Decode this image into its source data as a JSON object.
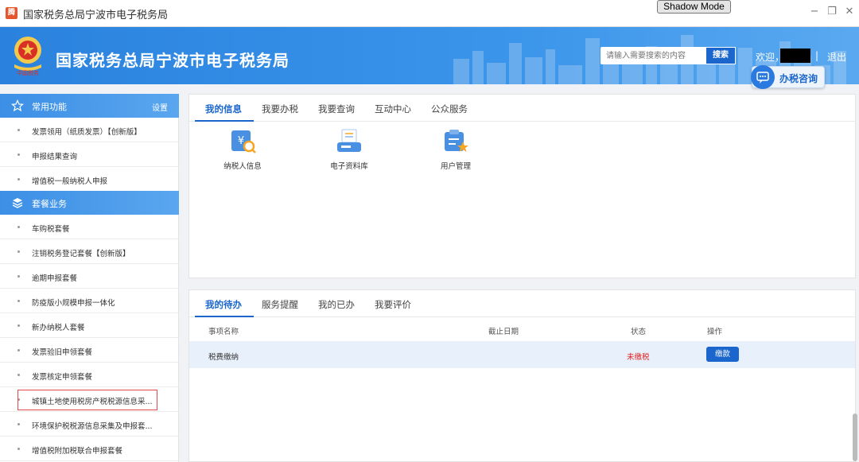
{
  "window": {
    "app_icon_text": "腾",
    "title": "国家税务总局宁波市电子税务局",
    "shadow_mode": "Shadow Mode",
    "controls": [
      "−",
      "❐",
      "✕"
    ]
  },
  "header": {
    "site_title": "国家税务总局宁波市电子税务局",
    "search_placeholder": "请输入需要搜索的内容",
    "search_button": "搜索",
    "welcome": "欢迎，",
    "separator": "|",
    "logout": "退出",
    "consult": "办税咨询"
  },
  "sidebar": {
    "common_section": {
      "label": "常用功能",
      "setting": "设置"
    },
    "common_items": [
      "发票领用（纸质发票）【创新版】",
      "申报结果查询",
      "增值税一般纳税人申报"
    ],
    "package_section": {
      "label": "套餐业务"
    },
    "package_items": [
      "车购税套餐",
      "注销税务登记套餐【创新版】",
      "逾期申报套餐",
      "防疫版小规模申报一体化",
      "新办纳税人套餐",
      "发票验旧申领套餐",
      "发票核定申领套餐",
      "城镇土地使用税房产税税源信息采...",
      "环境保护税税源信息采集及申报套...",
      "增值税附加税联合申报套餐"
    ]
  },
  "info_panel": {
    "tabs": [
      "我的信息",
      "我要办税",
      "我要查询",
      "互动中心",
      "公众服务"
    ],
    "active_tab": 0,
    "tiles": [
      "纳税人信息",
      "电子资料库",
      "用户管理"
    ]
  },
  "todo_panel": {
    "tabs": [
      "我的待办",
      "服务提醒",
      "我的已办",
      "我要评价"
    ],
    "active_tab": 0,
    "columns": [
      "事项名称",
      "截止日期",
      "状态",
      "操作"
    ],
    "rows": [
      {
        "name": "税费缴纳",
        "deadline": "",
        "status": "未缴税",
        "action": "缴款"
      }
    ]
  },
  "colors": {
    "primary": "#1a66cc",
    "banner": "#3b95ea",
    "unpaid": "#e02020",
    "highlight_border": "#e14a4a"
  }
}
